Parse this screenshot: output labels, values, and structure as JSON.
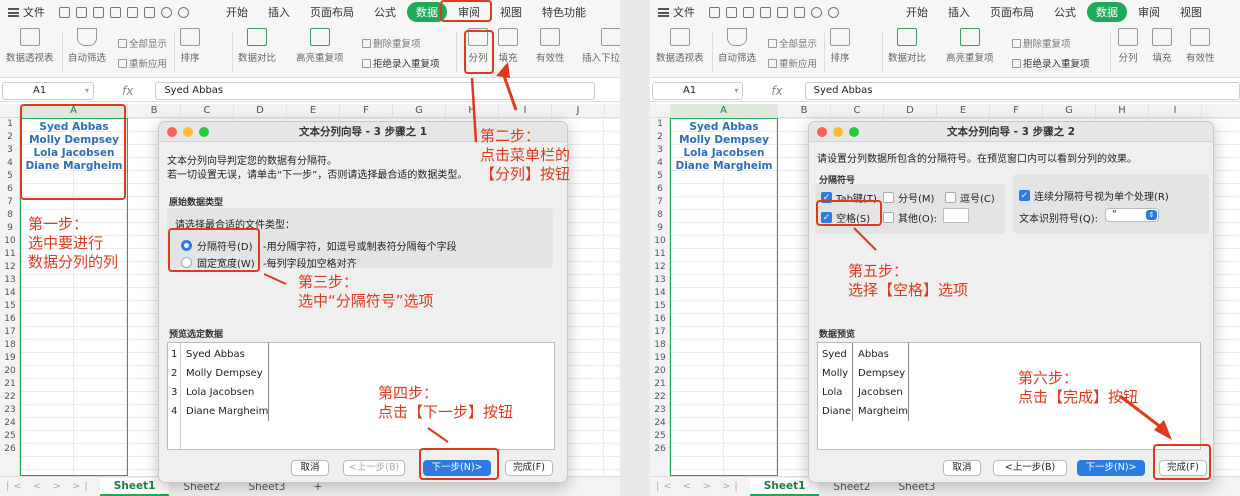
{
  "menubar": {
    "file": "文件",
    "tabs": [
      "开始",
      "插入",
      "页面布局",
      "公式",
      "数据",
      "审阅",
      "视图",
      "特色功能"
    ],
    "tabs_right": [
      "开始",
      "插入",
      "页面布局",
      "公式",
      "数据",
      "审阅",
      "视图"
    ],
    "active_tab": "数据",
    "active_color": "#1faa58"
  },
  "toolbar": {
    "pivot": "数据透视表",
    "autofilter": "自动筛选",
    "show_all": "全部显示",
    "reapply": "重新应用",
    "sort": "排序",
    "compare": "数据对比",
    "highlight_dup": "高亮重复项",
    "delete_dup": "删除重复项",
    "reject_dup": "拒绝录入重复项",
    "split": "分列",
    "fill": "填充",
    "validity": "有效性",
    "insert_dropdown": "插入下拉列表"
  },
  "formula_bar": {
    "cell_ref": "A1",
    "fx": "fx",
    "content": "Syed Abbas"
  },
  "columns": [
    "A",
    "B",
    "C",
    "D",
    "E",
    "F",
    "G",
    "H",
    "I",
    "J"
  ],
  "rows": [
    "1",
    "2",
    "3",
    "4",
    "5",
    "6",
    "7",
    "8",
    "9",
    "10",
    "11",
    "12",
    "13",
    "14",
    "15",
    "16",
    "17",
    "18",
    "19",
    "20",
    "21",
    "22",
    "23",
    "24",
    "25",
    "26"
  ],
  "names": [
    "Syed Abbas",
    "Molly Dempsey",
    "Lola Jacobsen",
    "Diane Margheim"
  ],
  "sheets": [
    "Sheet1",
    "Sheet2",
    "Sheet3"
  ],
  "add_sheet": "+",
  "sheet_nav": "|< < > >|",
  "dialog1": {
    "title": "文本分列向导 - 3 步骤之 1",
    "line1": "文本分列向导判定您的数据有分隔符。",
    "line2": "若一切设置无误，请单击“下一步”，否则请选择最合适的数据类型。",
    "group_label": "原始数据类型",
    "choose_label": "请选择最合适的文件类型：",
    "opt1": "分隔符号(D)",
    "opt1_desc": "-用分隔字符，如逗号或制表符分隔每个字段",
    "opt2": "固定宽度(W)",
    "opt2_desc": "-每列字段加空格对齐",
    "preview_label": "预览选定数据",
    "preview_nums": [
      "1",
      "2",
      "3",
      "4"
    ],
    "btn_cancel": "取消",
    "btn_prev": "<上一步(B)",
    "btn_next": "下一步(N)>",
    "btn_finish": "完成(F)"
  },
  "dialog2": {
    "title": "文本分列向导 - 3 步骤之 2",
    "line1": "请设置分列数据所包含的分隔符号。在预览窗口内可以看到分列的效果。",
    "group_label": "分隔符号",
    "tab": "Tab键(T)",
    "semicolon": "分号(M)",
    "comma": "逗号(C)",
    "space": "空格(S)",
    "other": "其他(O):",
    "consecutive": "连续分隔符号视为单个处理(R)",
    "qualifier_label": "文本识别符号(Q):",
    "qualifier_value": "\"",
    "preview_label": "数据预览",
    "first": [
      "Syed",
      "Molly",
      "Lola",
      "Diane"
    ],
    "last": [
      "Abbas",
      "Dempsey",
      "Jacobsen",
      "Margheim"
    ],
    "btn_cancel": "取消",
    "btn_prev": "<上一步(B)",
    "btn_next": "下一步(N)>",
    "btn_finish": "完成(F)"
  },
  "annotations": {
    "step1a": "第一步：",
    "step1b": "选中要进行",
    "step1c": "数据分列的列",
    "step2a": "第二步：",
    "step2b": "点击菜单栏的",
    "step2c": "【分列】按钮",
    "step3a": "第三步：",
    "step3b": "选中“分隔符号”选项",
    "step4a": "第四步：",
    "step4b": "点击【下一步】按钮",
    "step5a": "第五步：",
    "step5b": "选择【空格】选项",
    "step6a": "第六步：",
    "step6b": "点击【完成】按钮",
    "color": "#e03a1c"
  }
}
